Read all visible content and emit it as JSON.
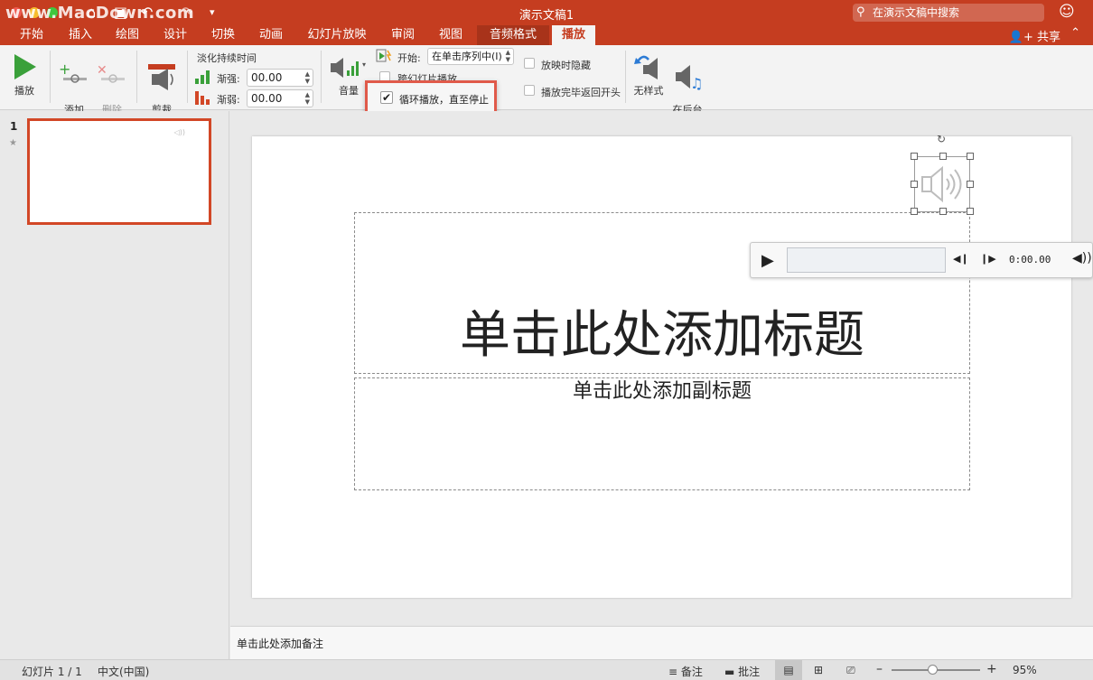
{
  "window": {
    "title": "演示文稿1",
    "watermark": "www.MacDown.com",
    "search_placeholder": "在演示文稿中搜索"
  },
  "tabs": [
    {
      "label": "开始"
    },
    {
      "label": "插入"
    },
    {
      "label": "绘图"
    },
    {
      "label": "设计"
    },
    {
      "label": "切换"
    },
    {
      "label": "动画"
    },
    {
      "label": "幻灯片放映"
    },
    {
      "label": "审阅"
    },
    {
      "label": "视图"
    },
    {
      "label": "音频格式"
    },
    {
      "label": "播放",
      "active": true
    }
  ],
  "share_label": "共享",
  "ribbon": {
    "play_label": "播放",
    "add_bookmark_label": "添加\n书签",
    "remove_bookmark_label": "删除\n书签",
    "trim_audio_label": "剪裁\n音频",
    "fade_duration_label": "淡化持续时间",
    "fade_in_label": "渐强:",
    "fade_in_value": "00.00",
    "fade_out_label": "渐弱:",
    "fade_out_value": "00.00",
    "volume_label": "音量",
    "start_label": "开始:",
    "start_value": "在单击序列中(I)",
    "play_across_slides_label": "跨幻灯片播放",
    "loop_label": "循环播放，直至停止",
    "loop_checked": true,
    "hide_during_show_label": "放映时隐藏",
    "rewind_label": "播放完毕返回开头",
    "no_style_label": "无样式",
    "play_in_background_label": "在后台\n播放"
  },
  "thumbnails": [
    {
      "number": "1",
      "selected": true
    }
  ],
  "slide": {
    "title_placeholder": "单击此处添加标题",
    "subtitle_placeholder": "单击此处添加副标题"
  },
  "player": {
    "time": "0:00.00"
  },
  "notes_placeholder": "单击此处添加备注",
  "status": {
    "slide_info": "幻灯片 1 / 1",
    "language": "中文(中国)",
    "notes_label": "备注",
    "comments_label": "批注",
    "zoom": "95%"
  },
  "colors": {
    "accent": "#c53d20",
    "highlight_box": "#e05a4a"
  }
}
